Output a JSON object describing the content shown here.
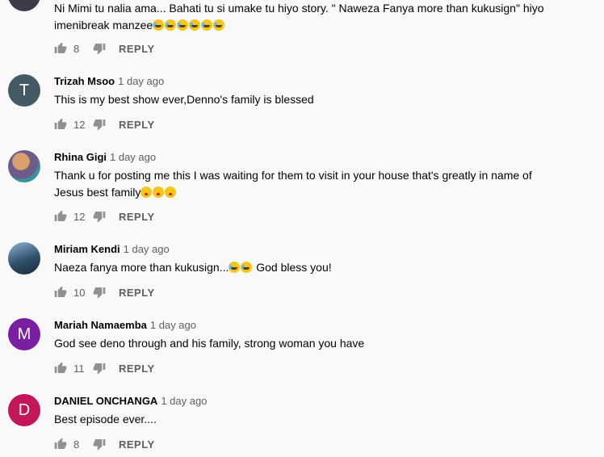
{
  "comments": [
    {
      "author": "",
      "time": "",
      "text_lines": [
        "Ni Mimi tu nalia ama... Bahati tu si umake tu hiyo story. \" Naweza Fanya more than kukusign\" hiyo",
        "imenibreak manzee"
      ],
      "emoji_count": 6,
      "likes": "8",
      "reply": "REPLY",
      "avatar": {
        "type": "photo",
        "color": "#3b3b4a"
      }
    },
    {
      "author": "Trizah Msoo",
      "time": "1 day ago",
      "text": "This is my best show ever,Denno's family is blessed",
      "likes": "12",
      "reply": "REPLY",
      "avatar": {
        "type": "letter",
        "letter": "T",
        "color": "#455a64"
      }
    },
    {
      "author": "Rhina Gigi",
      "time": "1 day ago",
      "text_lines": [
        "Thank u for posting me this I was waiting for them to visit in your house that's greatly in name of",
        "Jesus best family"
      ],
      "likes": "12",
      "reply": "REPLY",
      "avatar": {
        "type": "photo",
        "color": "#6d5b8a"
      }
    },
    {
      "author": "Miriam Kendi",
      "time": "1 day ago",
      "text_before": "Naeza fanya more than kukusign...",
      "text_after": "God bless you!",
      "likes": "10",
      "reply": "REPLY",
      "avatar": {
        "type": "photo",
        "color": "#2f4f6a"
      }
    },
    {
      "author": "Mariah Namaemba",
      "time": "1 day ago",
      "text": "God see deno through and his family, strong woman you have",
      "likes": "11",
      "reply": "REPLY",
      "avatar": {
        "type": "letter",
        "letter": "M",
        "color": "#7b1fa2"
      }
    },
    {
      "author": "DANIEL ONCHANGA",
      "time": "1 day ago",
      "text": "Best episode ever....",
      "likes": "8",
      "reply": "REPLY",
      "avatar": {
        "type": "letter",
        "letter": "D",
        "color": "#c2185b"
      }
    }
  ],
  "icons": {
    "like": "thumbs-up-icon",
    "dislike": "thumbs-down-icon"
  }
}
